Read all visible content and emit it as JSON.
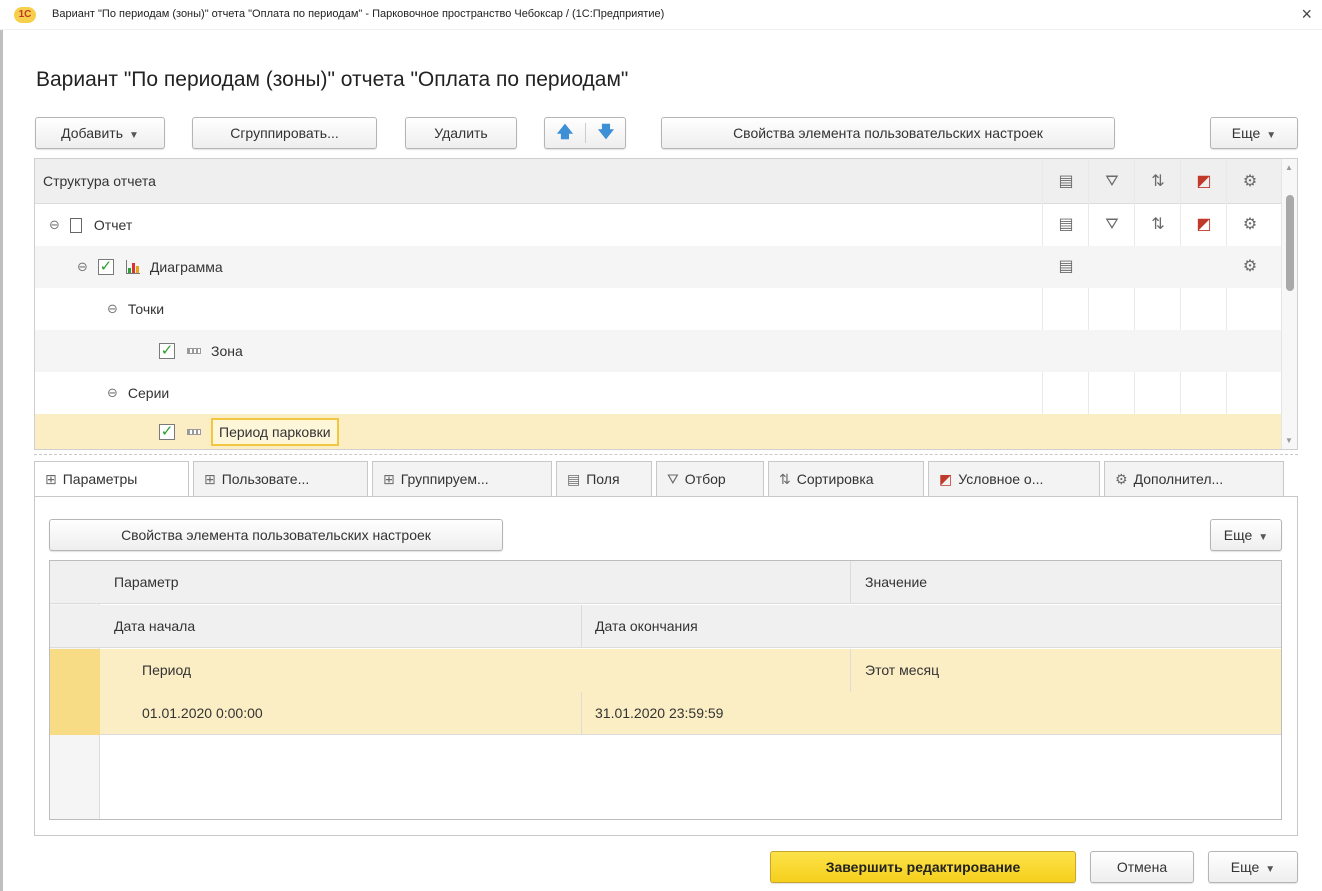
{
  "window": {
    "logo": "1С",
    "title": "Вариант \"По периодам (зоны)\" отчета \"Оплата по периодам\" - Парковочное пространство Чебоксар /  (1С:Предприятие)",
    "close_glyph": "×"
  },
  "heading": "Вариант \"По периодам (зоны)\" отчета \"Оплата по периодам\"",
  "toolbar": {
    "add_label": "Добавить",
    "group_label": "Сгруппировать...",
    "delete_label": "Удалить",
    "up_glyph": "🡅",
    "down_glyph": "🡇",
    "user_settings_label": "Свойства элемента пользовательских настроек",
    "more_label": "Еще"
  },
  "tree": {
    "header": "Структура отчета",
    "rows": [
      {
        "label": "Отчет",
        "type": "report"
      },
      {
        "label": "Диаграмма",
        "type": "chart",
        "checked": true
      },
      {
        "label": "Точки",
        "type": "group"
      },
      {
        "label": "Зона",
        "type": "field",
        "checked": true
      },
      {
        "label": "Серии",
        "type": "group"
      },
      {
        "label": "Период парковки",
        "type": "field",
        "checked": true,
        "selected": true
      }
    ],
    "column_icons": [
      "fields-icon",
      "filter-icon",
      "sort-icon",
      "conditional-format-icon",
      "extra-settings-icon"
    ]
  },
  "tabs": [
    {
      "label": "Параметры",
      "icon": "parameters-icon",
      "active": true
    },
    {
      "label": "Пользовате...",
      "icon": "user-fields-icon"
    },
    {
      "label": "Группируем...",
      "icon": "grouping-icon"
    },
    {
      "label": "Поля",
      "icon": "fields-icon"
    },
    {
      "label": "Отбор",
      "icon": "filter-icon"
    },
    {
      "label": "Сортировка",
      "icon": "sort-icon"
    },
    {
      "label": "Условное о...",
      "icon": "conditional-format-icon"
    },
    {
      "label": "Дополнител...",
      "icon": "extra-settings-icon"
    }
  ],
  "panel": {
    "user_settings_label": "Свойства элемента пользовательских настроек",
    "more_label": "Еще"
  },
  "params_table": {
    "headers": {
      "parameter": "Параметр",
      "value": "Значение",
      "start_date": "Дата начала",
      "end_date": "Дата окончания"
    },
    "rows": [
      {
        "parameter": "Период",
        "value": "Этот месяц",
        "start_date": "01.01.2020 0:00:00",
        "end_date": "31.01.2020 23:59:59"
      }
    ]
  },
  "footer": {
    "finish_label": "Завершить редактирование",
    "cancel_label": "Отмена",
    "more_label": "Еще"
  }
}
